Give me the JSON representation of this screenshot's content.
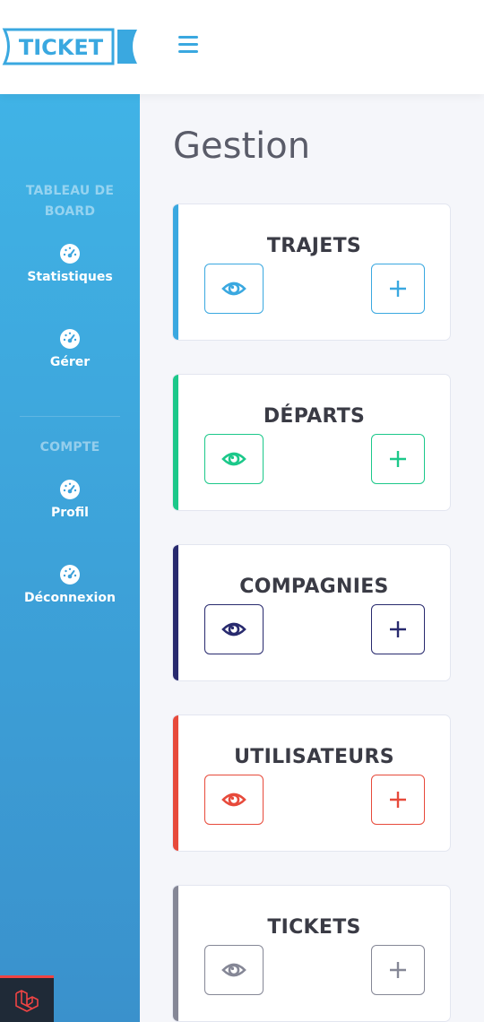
{
  "brand": {
    "name": "TICKET",
    "color": "#3aa8e0"
  },
  "sidebar": {
    "sections": [
      {
        "heading": "TABLEAU DE\nBOARD"
      },
      {
        "heading": "COMPTE"
      }
    ],
    "items": [
      {
        "label": "Statistiques",
        "icon": "tachometer-icon"
      },
      {
        "label": "Gérer",
        "icon": "tachometer-icon"
      },
      {
        "label": "Profil",
        "icon": "tachometer-icon"
      },
      {
        "label": "Déconnexion",
        "icon": "tachometer-icon"
      }
    ],
    "footer_icon": "laravel-icon"
  },
  "main": {
    "title": "Gestion",
    "cards": [
      {
        "title": "TRAJETS",
        "color": "#3aa8e0"
      },
      {
        "title": "DÉPARTS",
        "color": "#1cc88a"
      },
      {
        "title": "COMPAGNIES",
        "color": "#282a6e"
      },
      {
        "title": "UTILISATEURS",
        "color": "#e74a3b"
      },
      {
        "title": "TICKETS",
        "color": "#858796"
      }
    ]
  }
}
